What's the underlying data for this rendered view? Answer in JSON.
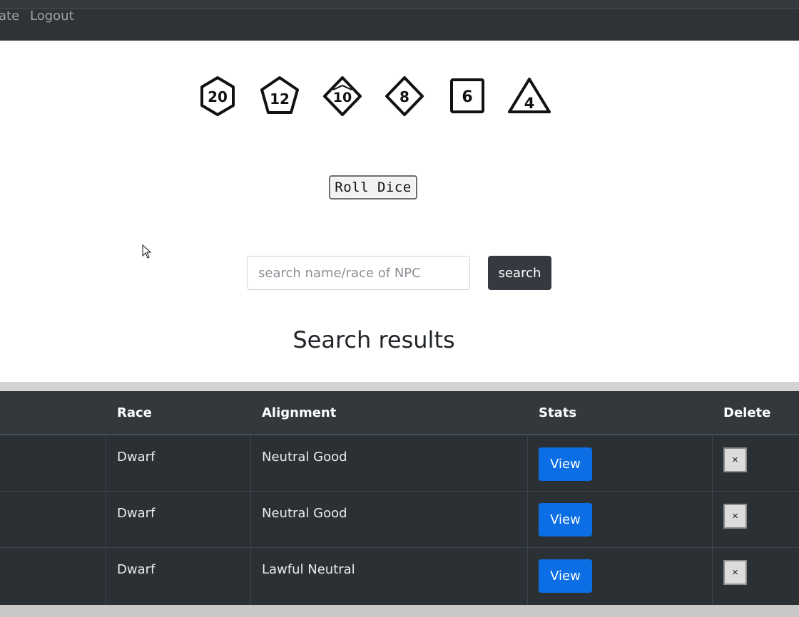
{
  "nav": {
    "partial_link": "ate",
    "logout": "Logout"
  },
  "dice": [
    {
      "label": "20",
      "shape": "hexagon",
      "icon": "d20-icon"
    },
    {
      "label": "12",
      "shape": "pentagon",
      "icon": "d12-icon"
    },
    {
      "label": "10",
      "shape": "diamond-kite",
      "icon": "d10-icon"
    },
    {
      "label": "8",
      "shape": "diamond",
      "icon": "d8-icon"
    },
    {
      "label": "6",
      "shape": "square",
      "icon": "d6-icon"
    },
    {
      "label": "4",
      "shape": "triangle",
      "icon": "d4-icon"
    }
  ],
  "roll_button": "Roll Dice",
  "search": {
    "placeholder": "search name/race of NPC",
    "value": "",
    "button": "search"
  },
  "results_heading": "Search results",
  "table": {
    "headers": [
      "Race",
      "Alignment",
      "Stats",
      "Delete"
    ],
    "rows": [
      {
        "race": "Dwarf",
        "alignment": "Neutral Good",
        "stats": "View",
        "delete": "×"
      },
      {
        "race": "Dwarf",
        "alignment": "Neutral Good",
        "stats": "View",
        "delete": "×"
      },
      {
        "race": "Dwarf",
        "alignment": "Lawful Neutral",
        "stats": "View",
        "delete": "×"
      }
    ]
  },
  "colors": {
    "navbar": "#2f3337",
    "table_bg": "#2b3035",
    "view_button": "#0b6ee4",
    "search_button": "#343a40"
  }
}
